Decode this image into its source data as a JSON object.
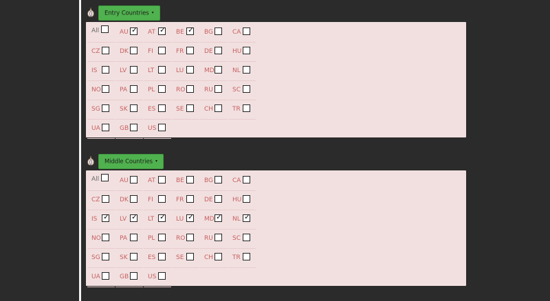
{
  "sections": [
    {
      "button_label": "Entry Countries",
      "caret": "▾",
      "rows": [
        [
          {
            "label": "All",
            "checked": false
          },
          {
            "label": "AU",
            "checked": true
          },
          {
            "label": "AT",
            "checked": true
          },
          {
            "label": "BE",
            "checked": true
          },
          {
            "label": "BG",
            "checked": false
          },
          {
            "label": "CA",
            "checked": false
          }
        ],
        [
          {
            "label": "CZ",
            "checked": false
          },
          {
            "label": "DK",
            "checked": false
          },
          {
            "label": "FI",
            "checked": false
          },
          {
            "label": "FR",
            "checked": false
          },
          {
            "label": "DE",
            "checked": false
          },
          {
            "label": "HU",
            "checked": false
          }
        ],
        [
          {
            "label": "IS",
            "checked": false
          },
          {
            "label": "LV",
            "checked": false
          },
          {
            "label": "LT",
            "checked": false
          },
          {
            "label": "LU",
            "checked": false
          },
          {
            "label": "MD",
            "checked": false
          },
          {
            "label": "NL",
            "checked": false
          }
        ],
        [
          {
            "label": "NO",
            "checked": false
          },
          {
            "label": "PA",
            "checked": false
          },
          {
            "label": "PL",
            "checked": false
          },
          {
            "label": "RO",
            "checked": false
          },
          {
            "label": "RU",
            "checked": false
          },
          {
            "label": "SC",
            "checked": false
          }
        ],
        [
          {
            "label": "SG",
            "checked": false
          },
          {
            "label": "SK",
            "checked": false
          },
          {
            "label": "ES",
            "checked": false
          },
          {
            "label": "SE",
            "checked": false
          },
          {
            "label": "CH",
            "checked": false
          },
          {
            "label": "TR",
            "checked": false
          }
        ],
        [
          {
            "label": "UA",
            "checked": false
          },
          {
            "label": "GB",
            "checked": false
          },
          {
            "label": "US",
            "checked": false
          }
        ]
      ]
    },
    {
      "button_label": "Middle Countries",
      "caret": "▾",
      "rows": [
        [
          {
            "label": "All",
            "checked": false
          },
          {
            "label": "AU",
            "checked": false
          },
          {
            "label": "AT",
            "checked": false
          },
          {
            "label": "BE",
            "checked": false
          },
          {
            "label": "BG",
            "checked": false
          },
          {
            "label": "CA",
            "checked": false
          }
        ],
        [
          {
            "label": "CZ",
            "checked": false
          },
          {
            "label": "DK",
            "checked": false
          },
          {
            "label": "FI",
            "checked": false
          },
          {
            "label": "FR",
            "checked": false
          },
          {
            "label": "DE",
            "checked": false
          },
          {
            "label": "HU",
            "checked": false
          }
        ],
        [
          {
            "label": "IS",
            "checked": true
          },
          {
            "label": "LV",
            "checked": true
          },
          {
            "label": "LT",
            "checked": true
          },
          {
            "label": "LU",
            "checked": true
          },
          {
            "label": "MD",
            "checked": true
          },
          {
            "label": "NL",
            "checked": true
          }
        ],
        [
          {
            "label": "NO",
            "checked": false
          },
          {
            "label": "PA",
            "checked": false
          },
          {
            "label": "PL",
            "checked": false
          },
          {
            "label": "RO",
            "checked": false
          },
          {
            "label": "RU",
            "checked": false
          },
          {
            "label": "SC",
            "checked": false
          }
        ],
        [
          {
            "label": "SG",
            "checked": false
          },
          {
            "label": "SK",
            "checked": false
          },
          {
            "label": "ES",
            "checked": false
          },
          {
            "label": "SE",
            "checked": false
          },
          {
            "label": "CH",
            "checked": false
          },
          {
            "label": "TR",
            "checked": false
          }
        ],
        [
          {
            "label": "UA",
            "checked": false
          },
          {
            "label": "GB",
            "checked": false
          },
          {
            "label": "US",
            "checked": false
          }
        ]
      ]
    }
  ],
  "icons": {
    "section_icon": "onion-icon",
    "checkmark": "✓"
  },
  "colors": {
    "button_bg": "#4fb24e",
    "panel_bg": "#f2e0e0",
    "label": "#c86060",
    "page_bg": "#2b2b2b"
  }
}
